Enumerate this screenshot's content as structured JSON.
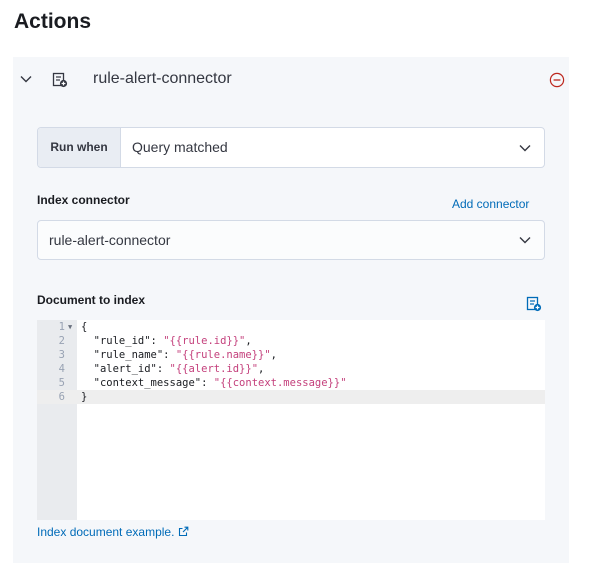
{
  "section": {
    "title": "Actions"
  },
  "action": {
    "connector_name": "rule-alert-connector",
    "run_when": {
      "label": "Run when",
      "value": "Query matched"
    },
    "index_connector": {
      "label": "Index connector",
      "add_link": "Add connector",
      "selected": "rule-alert-connector"
    },
    "document": {
      "label": "Document to index",
      "lines": [
        {
          "num": "1",
          "pre": "{",
          "str": "",
          "post": ""
        },
        {
          "num": "2",
          "pre": "  \"rule_id\": ",
          "str": "\"{{rule.id}}\"",
          "post": ","
        },
        {
          "num": "3",
          "pre": "  \"rule_name\": ",
          "str": "\"{{rule.name}}\"",
          "post": ","
        },
        {
          "num": "4",
          "pre": "  \"alert_id\": ",
          "str": "\"{{alert.id}}\"",
          "post": ","
        },
        {
          "num": "5",
          "pre": "  \"context_message\": ",
          "str": "\"{{context.message}}\"",
          "post": ""
        },
        {
          "num": "6",
          "pre": "}",
          "str": "",
          "post": ""
        }
      ],
      "example_link": "Index document example."
    }
  },
  "colors": {
    "accent": "#006bb8",
    "danger": "#bd271e",
    "string": "#c4407c"
  },
  "icons": {
    "collapse": "chevron-down-icon",
    "connector": "index-connector-icon",
    "remove": "minus-circle-icon",
    "add_variable": "add-variable-icon",
    "external": "external-link-icon"
  }
}
